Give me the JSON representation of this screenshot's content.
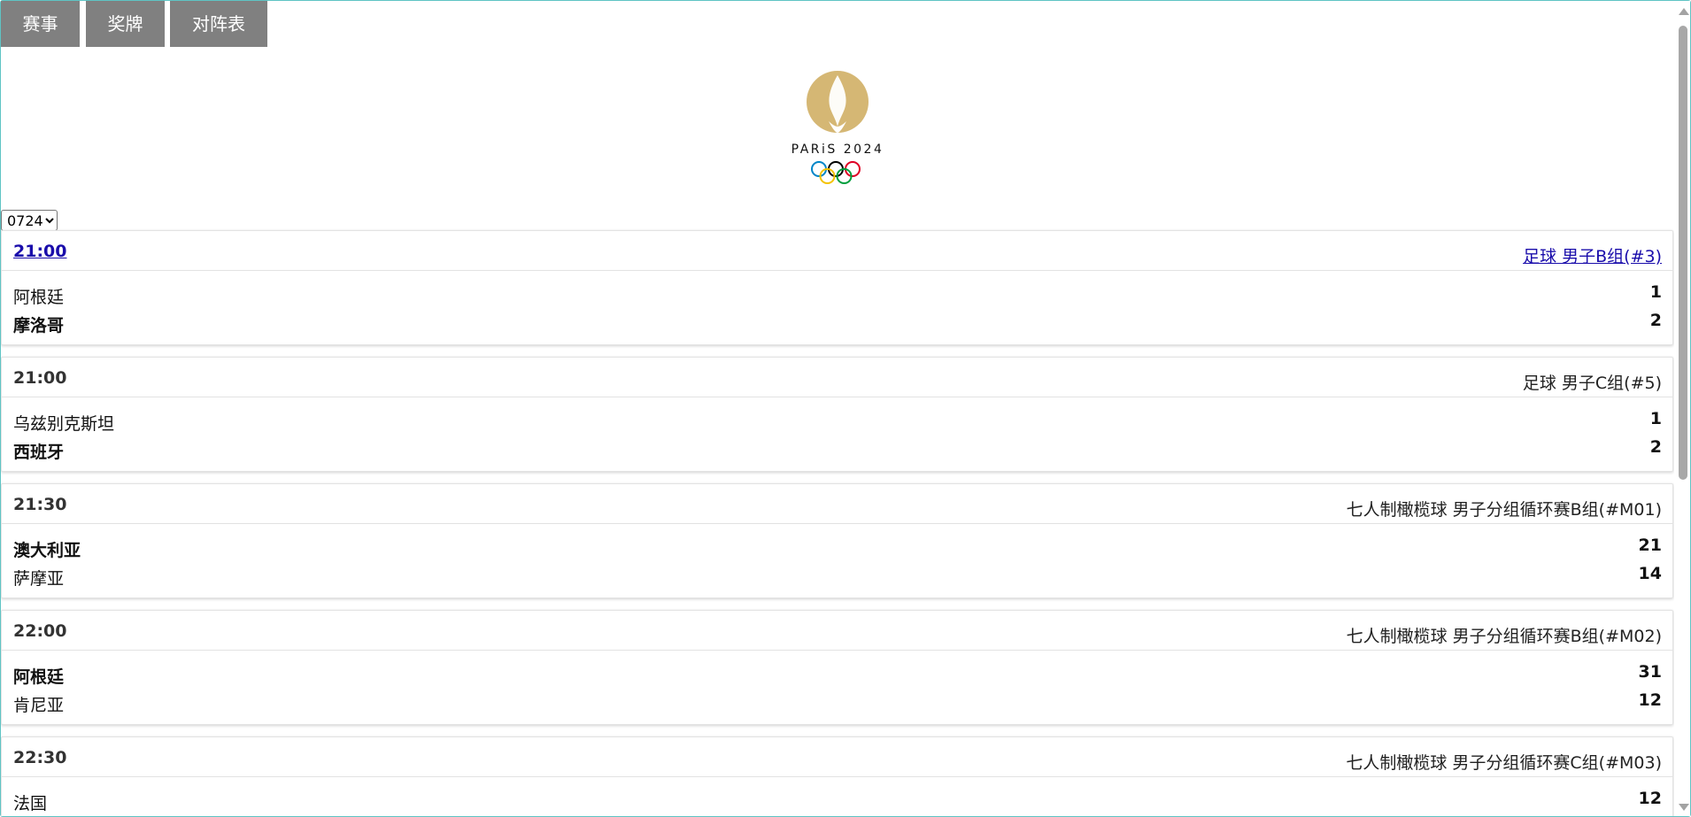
{
  "tabs": [
    {
      "label": "赛事"
    },
    {
      "label": "奖牌"
    },
    {
      "label": "对阵表"
    }
  ],
  "logo": {
    "wordmark": "PARiS 2024"
  },
  "date_select": {
    "selected": "0724"
  },
  "matches": [
    {
      "time": "21:00",
      "event": "足球 男子B组(#3)",
      "linked": true,
      "team1": "阿根廷",
      "score1": "1",
      "team2": "摩洛哥",
      "score2": "2",
      "winner": 2
    },
    {
      "time": "21:00",
      "event": "足球 男子C组(#5)",
      "linked": false,
      "team1": "乌兹别克斯坦",
      "score1": "1",
      "team2": "西班牙",
      "score2": "2",
      "winner": 2
    },
    {
      "time": "21:30",
      "event": "七人制橄榄球 男子分组循环赛B组(#M01)",
      "linked": false,
      "team1": "澳大利亚",
      "score1": "21",
      "team2": "萨摩亚",
      "score2": "14",
      "winner": 1
    },
    {
      "time": "22:00",
      "event": "七人制橄榄球 男子分组循环赛B组(#M02)",
      "linked": false,
      "team1": "阿根廷",
      "score1": "31",
      "team2": "肯尼亚",
      "score2": "12",
      "winner": 1
    },
    {
      "time": "22:30",
      "event": "七人制橄榄球 男子分组循环赛C组(#M03)",
      "linked": false,
      "team1": "法国",
      "score1": "12",
      "team2": "",
      "score2": "",
      "winner": 0
    }
  ],
  "colors": {
    "tab_bg": "#808080",
    "link": "#1a0dab",
    "logo_gold": "#d5b774",
    "ring_blue": "#0085c7",
    "ring_yellow": "#f4c300",
    "ring_black": "#000000",
    "ring_green": "#009f3d",
    "ring_red": "#df0024"
  }
}
